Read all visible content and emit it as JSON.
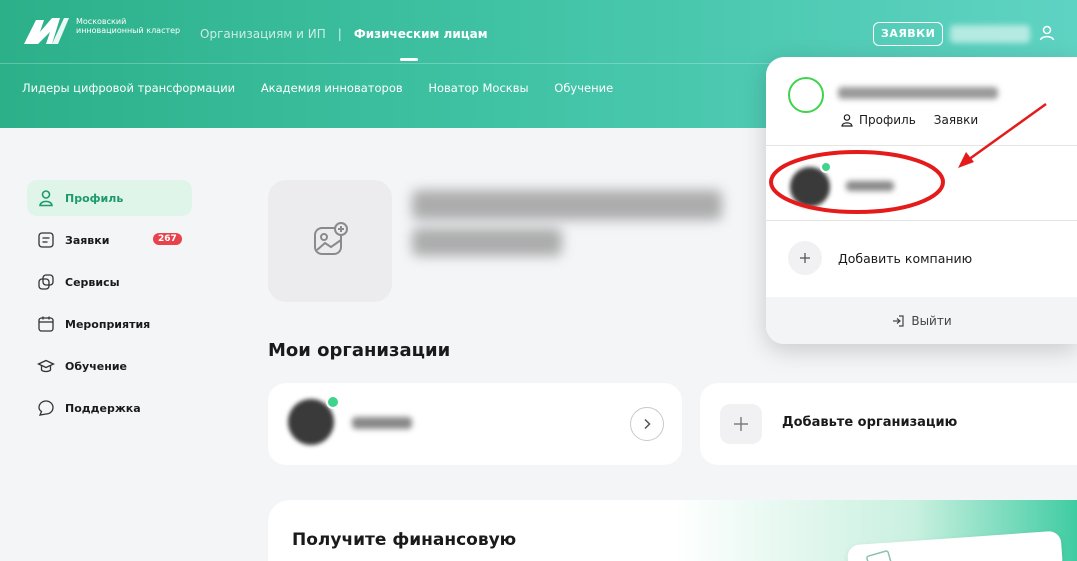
{
  "header": {
    "logo_text": "Московский инновационный кластер",
    "nav": {
      "org": "Организациям и ИП",
      "separator": "|",
      "individuals": "Физическим лицам"
    },
    "zayavki_button": "ЗАЯВКИ",
    "sub_nav": [
      "Лидеры цифровой трансформации",
      "Академия инноваторов",
      "Новатор Москвы",
      "Обучение"
    ]
  },
  "sidebar": {
    "items": [
      {
        "label": "Профиль",
        "icon": "user-icon"
      },
      {
        "label": "Заявки",
        "icon": "document-icon",
        "badge": "267"
      },
      {
        "label": "Сервисы",
        "icon": "services-icon"
      },
      {
        "label": "Мероприятия",
        "icon": "calendar-icon"
      },
      {
        "label": "Обучение",
        "icon": "graduation-icon"
      },
      {
        "label": "Поддержка",
        "icon": "support-icon"
      }
    ]
  },
  "main": {
    "section_title": "Мои организации",
    "add_org_label": "Добавьте организацию",
    "finance_title": "Получите финансовую"
  },
  "dropdown": {
    "profile_link": "Профиль",
    "requests_link": "Заявки",
    "add_company": "Добавить компанию",
    "logout": "Выйти"
  },
  "colors": {
    "accent": "#2cb08a",
    "badge": "#e8434c",
    "annotation": "#e51b1b",
    "online": "#3fd48c"
  }
}
